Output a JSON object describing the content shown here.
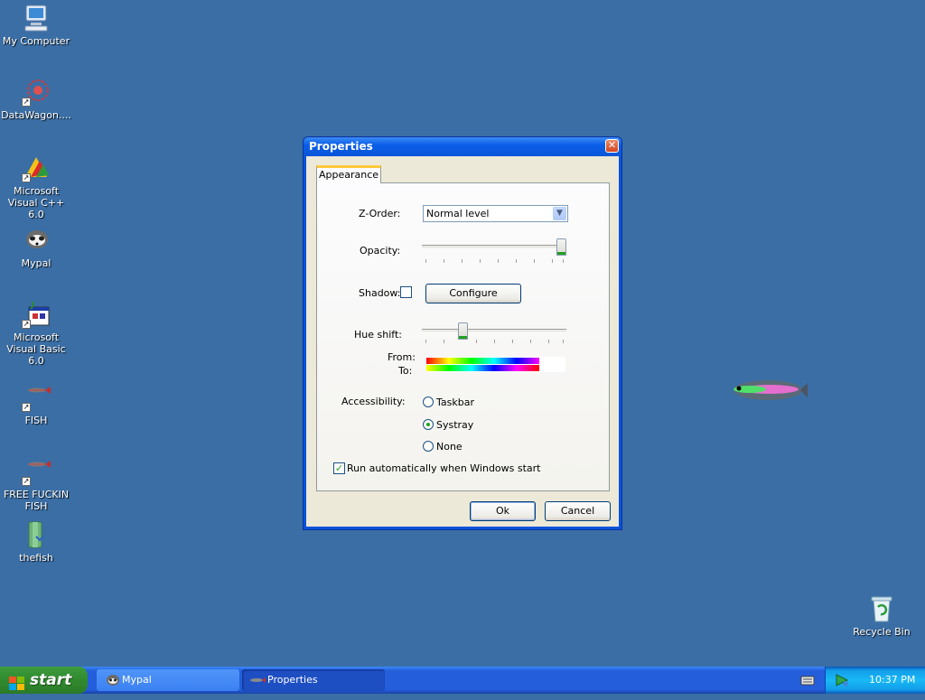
{
  "desktop": {
    "icons": [
      {
        "label": "My Computer",
        "icon": "computer-icon"
      },
      {
        "label": "DataWagon....",
        "icon": "datawagon-icon"
      },
      {
        "label": "Microsoft Visual C++ 6.0",
        "icon": "visual-cpp-icon"
      },
      {
        "label": "Mypal",
        "icon": "mypal-icon"
      },
      {
        "label": "Microsoft Visual Basic 6.0",
        "icon": "visual-basic-icon"
      },
      {
        "label": "FISH",
        "icon": "fish-icon"
      },
      {
        "label": "FREE FUCKIN FISH",
        "icon": "fish-icon"
      },
      {
        "label": "thefish",
        "icon": "folder-icon"
      },
      {
        "label": "Recycle Bin",
        "icon": "recycle-bin-icon"
      }
    ]
  },
  "dialog": {
    "title": "Properties",
    "tab": "Appearance",
    "zorder": {
      "label": "Z-Order:",
      "value": "Normal level"
    },
    "opacity": {
      "label": "Opacity:",
      "value_fraction": 1.0
    },
    "shadow": {
      "label": "Shadow:",
      "checked": false,
      "configure_label": "Configure"
    },
    "hue_shift": {
      "label": "Hue shift:",
      "value_fraction": 0.27
    },
    "from_label": "From:",
    "to_label": "To:",
    "accessibility": {
      "label": "Accessibility:",
      "options": [
        "Taskbar",
        "Systray",
        "None"
      ],
      "selected": "Systray"
    },
    "autorun": {
      "label": "Run automatically when Windows start",
      "checked": true
    },
    "ok_label": "Ok",
    "cancel_label": "Cancel"
  },
  "taskbar": {
    "start_label": "start",
    "tasks": [
      {
        "label": "Mypal",
        "icon": "mypal-icon"
      },
      {
        "label": "Properties",
        "icon": "fish-icon"
      }
    ],
    "clock": "10:37 PM",
    "colors": {
      "accent": "#245edb",
      "tray": "#139ee9",
      "start": "#318a2f"
    }
  }
}
